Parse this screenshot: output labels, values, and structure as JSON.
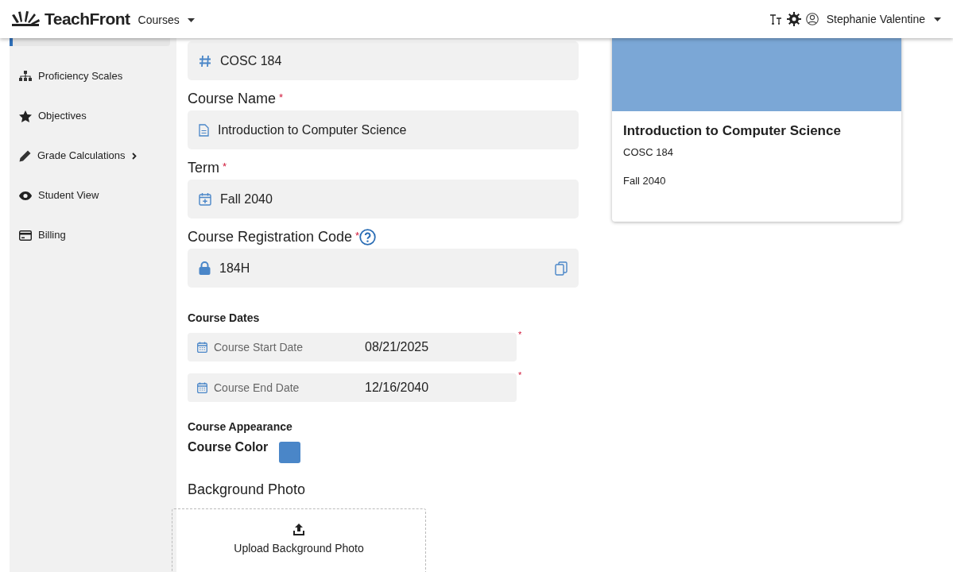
{
  "header": {
    "brand": "TeachFront",
    "menu": "Courses",
    "user": "Stephanie Valentine"
  },
  "sidebar": {
    "items": [
      {
        "label": "Proficiency Scales",
        "kind": "hierarchy",
        "has_submenu": false
      },
      {
        "label": "Objectives",
        "kind": "star",
        "has_submenu": false
      },
      {
        "label": "Grade Calculations",
        "kind": "pencil",
        "has_submenu": true
      },
      {
        "label": "Student View",
        "kind": "eye",
        "has_submenu": false
      },
      {
        "label": "Billing",
        "kind": "card",
        "has_submenu": false
      }
    ]
  },
  "form": {
    "fields": [
      {
        "kind": "code",
        "value": "COSC 184"
      },
      {
        "kind": "text",
        "label": "Course Name",
        "required_mark": "*",
        "value": "Introduction to Computer Science"
      },
      {
        "kind": "term",
        "label": "Term",
        "required_mark": "*",
        "value": "Fall 2040"
      },
      {
        "kind": "locked",
        "label": "Course Registration Code",
        "required_mark": "*",
        "help": true,
        "value": "184H"
      }
    ],
    "dates_heading": "Course Dates",
    "dates": [
      {
        "label": "Course Start Date",
        "value": "08/21/2025",
        "required_mark": "*"
      },
      {
        "label": "Course End Date",
        "value": "12/16/2040",
        "required_mark": "*"
      }
    ],
    "appearance_heading": "Course Appearance",
    "color_label": "Course Color",
    "color": "#4a86c8",
    "photo_label": "Background Photo",
    "upload": "Upload Background Photo"
  },
  "preview": {
    "title": "Introduction to Computer Science",
    "code": "COSC 184",
    "term": "Fall 2040"
  }
}
